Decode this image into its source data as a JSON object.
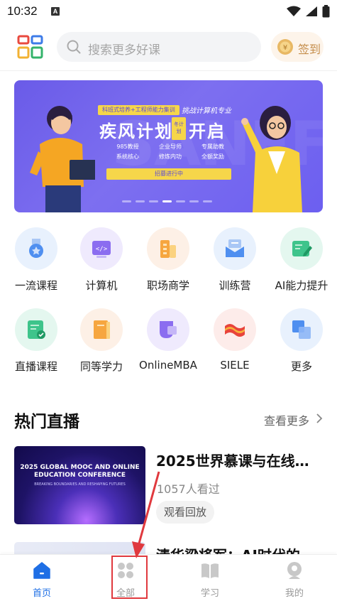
{
  "status_bar": {
    "time": "10:32",
    "notification_icon": "A"
  },
  "header": {
    "search_placeholder": "搜索更多好课",
    "signin_label": "签到"
  },
  "banner": {
    "subtitle": "科班式培养+工程师能力集训",
    "tag": "挑战计算机专业",
    "title_part1": "疾风计划",
    "mini_badge": "冬计划",
    "title_part2": "开启",
    "features": [
      "985教授",
      "企业导师",
      "专属助教",
      "系统核心",
      "修炼内功",
      "全额奖励"
    ],
    "cta": "招募进行中",
    "watermark": "SANEF",
    "dot_count": 7,
    "active_dot": 3
  },
  "categories": [
    {
      "label": "一流课程",
      "icon": "medal-icon"
    },
    {
      "label": "计算机",
      "icon": "code-icon"
    },
    {
      "label": "职场商学",
      "icon": "building-icon"
    },
    {
      "label": "训练营",
      "icon": "mail-icon"
    },
    {
      "label": "AI能力提升",
      "icon": "ai-edit-icon"
    },
    {
      "label": "直播课程",
      "icon": "live-doc-icon"
    },
    {
      "label": "同等学力",
      "icon": "book-icon"
    },
    {
      "label": "OnlineMBA",
      "icon": "mba-icon"
    },
    {
      "label": "SIELE",
      "icon": "flag-icon"
    },
    {
      "label": "更多",
      "icon": "more-icon"
    }
  ],
  "hot_live": {
    "title": "热门直播",
    "more_label": "查看更多",
    "items": [
      {
        "title": "2025世界慕课与在线…",
        "viewers": "1057人看过",
        "action": "观看回放",
        "thumb_title": "2025 GLOBAL MOOC AND ONLINE EDUCATION CONFERENCE",
        "thumb_subtitle": "BREAKING BOUNDARIES AND RESHAPING FUTURES"
      },
      {
        "title": "清华梁将军：AI时代的"
      }
    ]
  },
  "tab_bar": [
    {
      "label": "首页",
      "icon": "home-icon",
      "active": true
    },
    {
      "label": "全部",
      "icon": "grid-icon",
      "active": false
    },
    {
      "label": "学习",
      "icon": "open-book-icon",
      "active": false
    },
    {
      "label": "我的",
      "icon": "profile-icon",
      "active": false
    }
  ],
  "colors": {
    "accent_blue": "#1f6fe5",
    "banner_purple": "#7064ef",
    "annotation_red": "#e0393e",
    "signin_gold": "#c58d4a"
  }
}
